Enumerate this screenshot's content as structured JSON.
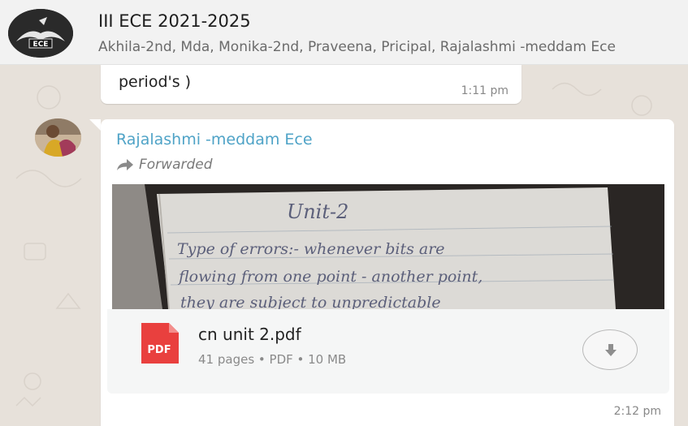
{
  "header": {
    "title": "III ECE 2021-2025",
    "members": "Akhila-2nd, Mda, Monika-2nd, Praveena, Pricipal, Rajalashmi -meddam Ece",
    "avatar_icon": "group-logo-icon",
    "avatar_logo_text": "ECE"
  },
  "messages": {
    "previous": {
      "text": "period's )",
      "time": "1:11 pm"
    },
    "current": {
      "sender": "Rajalashmi -meddam Ece",
      "forwarded_label": "Forwarded",
      "preview": {
        "heading": "Unit-2",
        "line1": "Type of errors:- whenever bits are",
        "line2": "flowing from one point - another point,",
        "line3": "they are subject to unpredictable"
      },
      "file": {
        "icon": "pdf-icon",
        "icon_label": "PDF",
        "name": "cn unit 2.pdf",
        "meta": "41 pages • PDF • 10 MB"
      },
      "download_icon": "download-icon",
      "time": "2:12 pm"
    }
  },
  "colors": {
    "sender_name": "#4fa3c7",
    "pdf_red": "#e9403e",
    "chat_background": "#e7e1da"
  }
}
